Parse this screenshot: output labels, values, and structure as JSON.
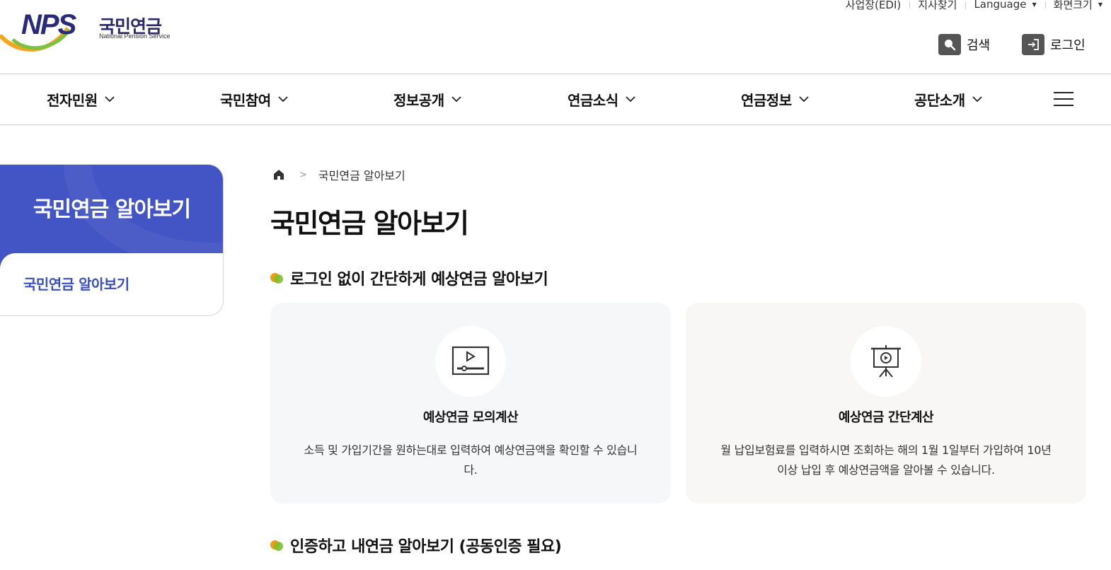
{
  "logo": {
    "mark": "NPS",
    "name_ko": "국민연금",
    "name_en": "National Pension Service"
  },
  "utility": {
    "items": [
      "사업장(EDI)",
      "지사찾기",
      "Language",
      "화면크기"
    ]
  },
  "header_buttons": {
    "search": "검색",
    "login": "로그인"
  },
  "nav": {
    "items": [
      "전자민원",
      "국민참여",
      "정보공개",
      "연금소식",
      "연금정보",
      "공단소개"
    ]
  },
  "lnb": {
    "title": "국민연금 알아보기",
    "items": [
      "국민연금 알아보기"
    ]
  },
  "breadcrumb": {
    "current": "국민연금 알아보기"
  },
  "page": {
    "title": "국민연금 알아보기"
  },
  "section1": {
    "title": "로그인 없이 간단하게 예상연금 알아보기",
    "cards": [
      {
        "icon": "video-play-icon",
        "title": "예상연금 모의계산",
        "desc": "소득 및 가입기간을 원하는대로 입력하여 예상연금액을 확인할 수 있습니다."
      },
      {
        "icon": "presentation-board-icon",
        "title": "예상연금 간단계산",
        "desc": "월 납입보험료를 입력하시면 조회하는 해의 1월 1일부터 가입하여 10년 이상 납입 후 예상연금액을 알아볼 수 있습니다."
      }
    ]
  },
  "section2": {
    "title": "인증하고 내연금 알아보기 (공동인증 필요)"
  },
  "colors": {
    "lnb_bg": "#4355c4",
    "lnb_link": "#3a4fc0",
    "dot_orange": "#f29a12",
    "dot_green": "#7cbf2f"
  }
}
